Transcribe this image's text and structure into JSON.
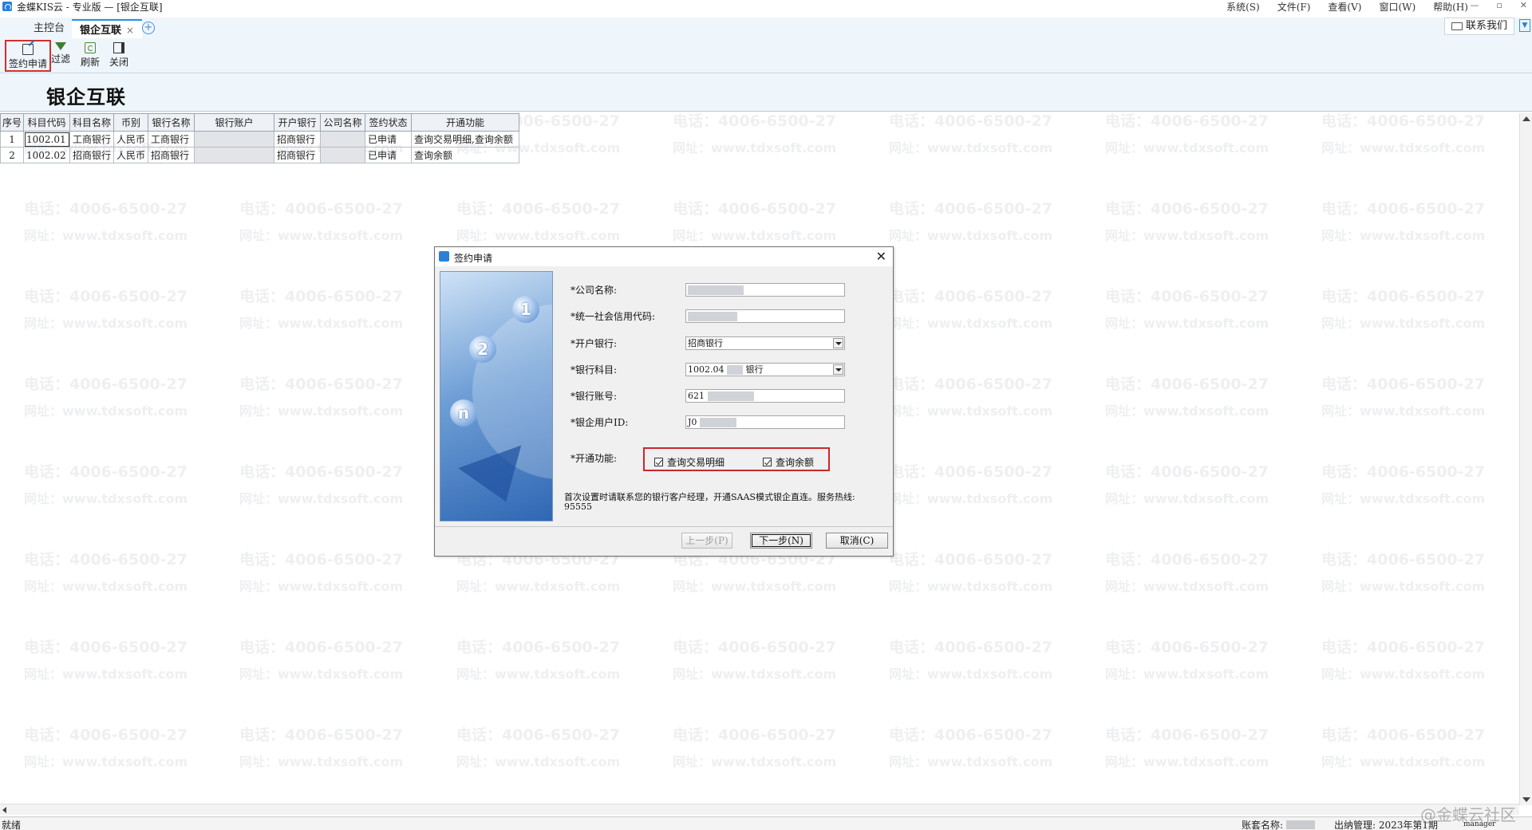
{
  "app": {
    "title": "金蝶KIS云 - 专业版 — [银企互联]",
    "menus": [
      "系统(S)",
      "文件(F)",
      "查看(V)",
      "窗口(W)",
      "帮助(H)"
    ],
    "window_controls": [
      "—",
      "▫",
      "✕"
    ]
  },
  "tabs": [
    {
      "label": "主控台",
      "active": false
    },
    {
      "label": "银企互联",
      "active": true,
      "close": "×"
    }
  ],
  "tab_add": "+",
  "contact_button": "联系我们",
  "toolbar": {
    "sign_apply": "签约申请",
    "filter": "过滤",
    "refresh": "刷新",
    "close": "关闭"
  },
  "page_title": "银企互联",
  "table": {
    "columns": [
      "序号",
      "科目代码",
      "科目名称",
      "币别",
      "银行名称",
      "银行账户",
      "开户银行",
      "公司名称",
      "签约状态",
      "开通功能"
    ],
    "rows": [
      {
        "seq": "1",
        "code": "1002.01",
        "name": "工商银行",
        "currency": "人民币",
        "bank": "工商银行",
        "account": "",
        "open_bank": "招商银行",
        "company": "",
        "status": "已申请",
        "functions": "查询交易明细,查询余额"
      },
      {
        "seq": "2",
        "code": "1002.02",
        "name": "招商银行",
        "currency": "人民币",
        "bank": "招商银行",
        "account": "",
        "open_bank": "招商银行",
        "company": "",
        "status": "已申请",
        "functions": "查询余额"
      }
    ]
  },
  "watermark": {
    "phone": "电话：4006-6500-27",
    "site": "网址：www.tdxsoft.com"
  },
  "dialog": {
    "title": "签约申请",
    "close": "✕",
    "wizard_numbers": [
      "1",
      "2",
      "n"
    ],
    "fields": {
      "company_label": "*公司名称:",
      "credit_code_label": "*统一社会信用代码:",
      "open_bank_label": "*开户银行:",
      "open_bank_value": "招商银行",
      "bank_subject_label": "*银行科目:",
      "bank_subject_code": "1002.04",
      "bank_subject_suffix": "银行",
      "bank_account_label": "*银行账号:",
      "bank_account_prefix": "621",
      "bank_user_id_label": "*银企用户ID:",
      "bank_user_id_prefix": "J0"
    },
    "functions_label": "*开通功能:",
    "functions": [
      {
        "label": "查询交易明细",
        "checked": true
      },
      {
        "label": "查询余额",
        "checked": true
      }
    ],
    "hint": "首次设置时请联系您的银行客户经理，开通SAAS模式银企直连。服务热线: 95555",
    "buttons": {
      "prev": "上一步(P)",
      "next": "下一步(N)",
      "cancel": "取消(C)"
    }
  },
  "statusbar": {
    "ready": "就绪",
    "account_label": "账套名称:",
    "period": "出纳管理: 2023年第1期",
    "user": "manager"
  },
  "community_mark": "@金蝶云社区"
}
